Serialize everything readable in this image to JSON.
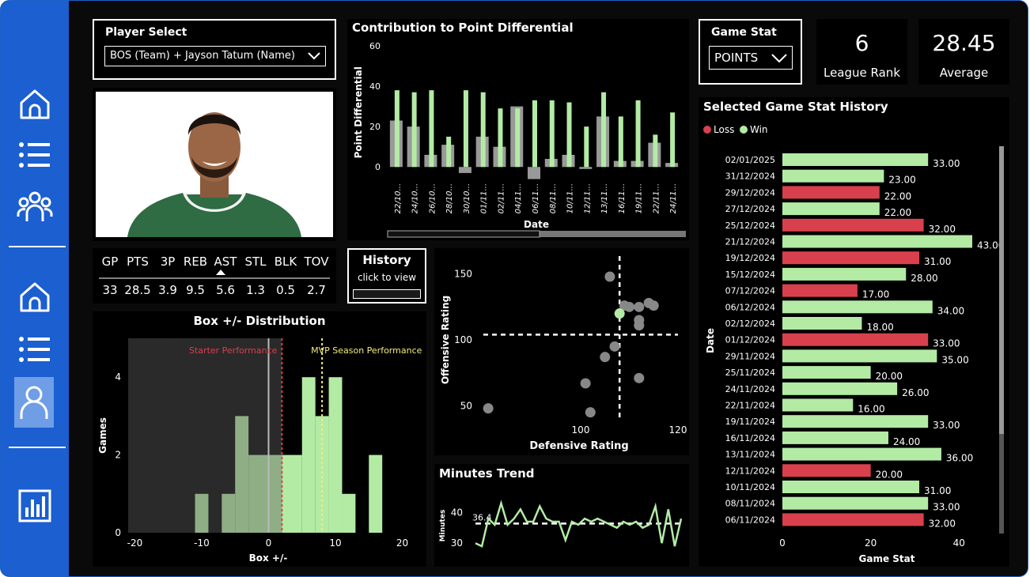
{
  "nav": {
    "icons": [
      "home-icon",
      "list-icon",
      "people-icon",
      "home-icon",
      "list-icon",
      "person-icon",
      "bar-chart-icon"
    ]
  },
  "player_select": {
    "title": "Player Select",
    "value": "BOS (Team) + Jayson Tatum (Name)"
  },
  "stats": {
    "headers": [
      "GP",
      "PTS",
      "3P",
      "REB",
      "AST",
      "STL",
      "BLK",
      "TOV"
    ],
    "values": [
      "33",
      "28.5",
      "3.9",
      "9.5",
      "5.6",
      "1.3",
      "0.5",
      "2.7"
    ]
  },
  "history_button": {
    "title": "History",
    "caption": "click to view"
  },
  "game_stat": {
    "title": "Game Stat",
    "value": "POINTS"
  },
  "kpis": [
    {
      "value": "6",
      "label": "League Rank"
    },
    {
      "value": "28.45",
      "label": "Average"
    }
  ],
  "colors": {
    "win": "#b3eba5",
    "loss": "#d9404d",
    "neutral": "#999999",
    "sidebar": "#1b5fd0"
  },
  "chart_data": [
    {
      "type": "bar",
      "title": "Contribution to Point Differential",
      "xlabel": "Date",
      "ylabel": "Point Differential",
      "ylim": [
        -5,
        60
      ],
      "yticks": [
        0,
        20,
        40,
        60
      ],
      "categories": [
        "22/10...",
        "24/10...",
        "26/10...",
        "28/10...",
        "30/10...",
        "01/11...",
        "02/11...",
        "04/11...",
        "06/11...",
        "08/11...",
        "10/11...",
        "12/11...",
        "13/11...",
        "16/11...",
        "19/11...",
        "22/11...",
        "24/11..."
      ],
      "series": [
        {
          "values": [
            23,
            20,
            6,
            11,
            -3,
            15,
            10,
            30,
            -6,
            4,
            6,
            -1,
            25,
            3,
            3,
            12,
            2
          ]
        },
        {
          "values": [
            38,
            37,
            38,
            15,
            38,
            37,
            29,
            29,
            33,
            33,
            32,
            20,
            37,
            25,
            33,
            16,
            27
          ]
        }
      ]
    },
    {
      "type": "scatter",
      "xlabel": "Defensive Rating",
      "ylabel": "Offensive Rating",
      "xlim": [
        80,
        120
      ],
      "ylim": [
        40,
        160
      ],
      "xticks": [
        100,
        120
      ],
      "yticks": [
        50,
        100,
        150
      ],
      "ref_x": 108,
      "ref_y": 104,
      "points": [
        [
          81,
          48
        ],
        [
          102,
          45
        ],
        [
          101,
          67
        ],
        [
          105,
          87
        ],
        [
          107,
          95
        ],
        [
          106,
          148
        ],
        [
          109,
          126
        ],
        [
          110,
          125
        ],
        [
          112,
          125
        ],
        [
          112,
          115
        ],
        [
          112,
          111
        ],
        [
          114,
          128
        ],
        [
          115,
          126
        ],
        [
          112,
          71
        ]
      ],
      "highlight": [
        108,
        120
      ]
    },
    {
      "type": "line",
      "title": "Minutes Trend",
      "ylabel": "Minutes",
      "yticks": [
        30,
        40
      ],
      "ylim": [
        28,
        46
      ],
      "average": 36.4,
      "average_label": "36.4",
      "values": [
        30,
        29,
        38,
        36,
        43,
        36,
        38,
        41,
        37,
        37,
        42,
        38,
        37,
        37,
        31,
        37,
        36,
        38,
        37,
        38,
        37,
        36,
        35,
        37,
        36,
        37,
        35,
        36,
        42,
        30,
        41,
        29,
        38
      ]
    },
    {
      "type": "histogram",
      "title": "Box +/- Distribution",
      "xlabel": "Box +/-",
      "ylabel": "Games",
      "xlim": [
        -21,
        21
      ],
      "ylim": [
        0,
        5
      ],
      "xticks": [
        -20,
        -10,
        0,
        10,
        20
      ],
      "yticks": [
        0,
        2,
        4
      ],
      "bins": [
        {
          "x0": -11,
          "x1": -9,
          "count": 1
        },
        {
          "x0": -7,
          "x1": -5,
          "count": 1
        },
        {
          "x0": -5,
          "x1": -3,
          "count": 3
        },
        {
          "x0": -3,
          "x1": 2,
          "count": 2
        },
        {
          "x0": 2,
          "x1": 5,
          "count": 2
        },
        {
          "x0": 5,
          "x1": 7,
          "count": 4
        },
        {
          "x0": 7,
          "x1": 9,
          "count": 3
        },
        {
          "x0": 9,
          "x1": 11,
          "count": 4
        },
        {
          "x0": 11,
          "x1": 13,
          "count": 1
        },
        {
          "x0": 15,
          "x1": 17,
          "count": 2
        }
      ],
      "shaded_until": 2,
      "ref_zero": 0,
      "starter_line": 2,
      "mvp_line": 8,
      "starter_label": "Starter Performance",
      "mvp_label": "MVP Season Performance"
    },
    {
      "type": "bar",
      "orientation": "horizontal",
      "title": "Selected Game Stat History",
      "xlabel": "Game Stat",
      "ylabel": "Date",
      "xlim": [
        0,
        43
      ],
      "xticks": [
        0,
        20,
        40
      ],
      "legend": [
        {
          "name": "Loss"
        },
        {
          "name": "Win"
        }
      ],
      "rows": [
        {
          "date": "02/01/2025",
          "value": 33,
          "label": "33.00",
          "result": "win"
        },
        {
          "date": "31/12/2024",
          "value": 23,
          "label": "23.00",
          "result": "win"
        },
        {
          "date": "29/12/2024",
          "value": 22,
          "label": "22.00",
          "result": "loss"
        },
        {
          "date": "27/12/2024",
          "value": 22,
          "label": "22.00",
          "result": "win"
        },
        {
          "date": "25/12/2024",
          "value": 32,
          "label": "32.00",
          "result": "loss"
        },
        {
          "date": "21/12/2024",
          "value": 43,
          "label": "43.00",
          "result": "win"
        },
        {
          "date": "19/12/2024",
          "value": 31,
          "label": "31.00",
          "result": "loss"
        },
        {
          "date": "15/12/2024",
          "value": 28,
          "label": "28.00",
          "result": "win"
        },
        {
          "date": "07/12/2024",
          "value": 17,
          "label": "17.00",
          "result": "loss"
        },
        {
          "date": "06/12/2024",
          "value": 34,
          "label": "34.00",
          "result": "win"
        },
        {
          "date": "02/12/2024",
          "value": 18,
          "label": "18.00",
          "result": "win"
        },
        {
          "date": "01/12/2024",
          "value": 33,
          "label": "33.00",
          "result": "loss"
        },
        {
          "date": "29/11/2024",
          "value": 35,
          "label": "35.00",
          "result": "win"
        },
        {
          "date": "25/11/2024",
          "value": 20,
          "label": "20.00",
          "result": "win"
        },
        {
          "date": "24/11/2024",
          "value": 26,
          "label": "26.00",
          "result": "win"
        },
        {
          "date": "22/11/2024",
          "value": 16,
          "label": "16.00",
          "result": "win"
        },
        {
          "date": "19/11/2024",
          "value": 33,
          "label": "33.00",
          "result": "win"
        },
        {
          "date": "16/11/2024",
          "value": 24,
          "label": "24.00",
          "result": "win"
        },
        {
          "date": "13/11/2024",
          "value": 36,
          "label": "36.00",
          "result": "win"
        },
        {
          "date": "12/11/2024",
          "value": 20,
          "label": "20.00",
          "result": "loss"
        },
        {
          "date": "10/11/2024",
          "value": 31,
          "label": "31.00",
          "result": "win"
        },
        {
          "date": "08/11/2024",
          "value": 33,
          "label": "33.00",
          "result": "win"
        },
        {
          "date": "06/11/2024",
          "value": 32,
          "label": "32.00",
          "result": "loss"
        }
      ]
    }
  ]
}
